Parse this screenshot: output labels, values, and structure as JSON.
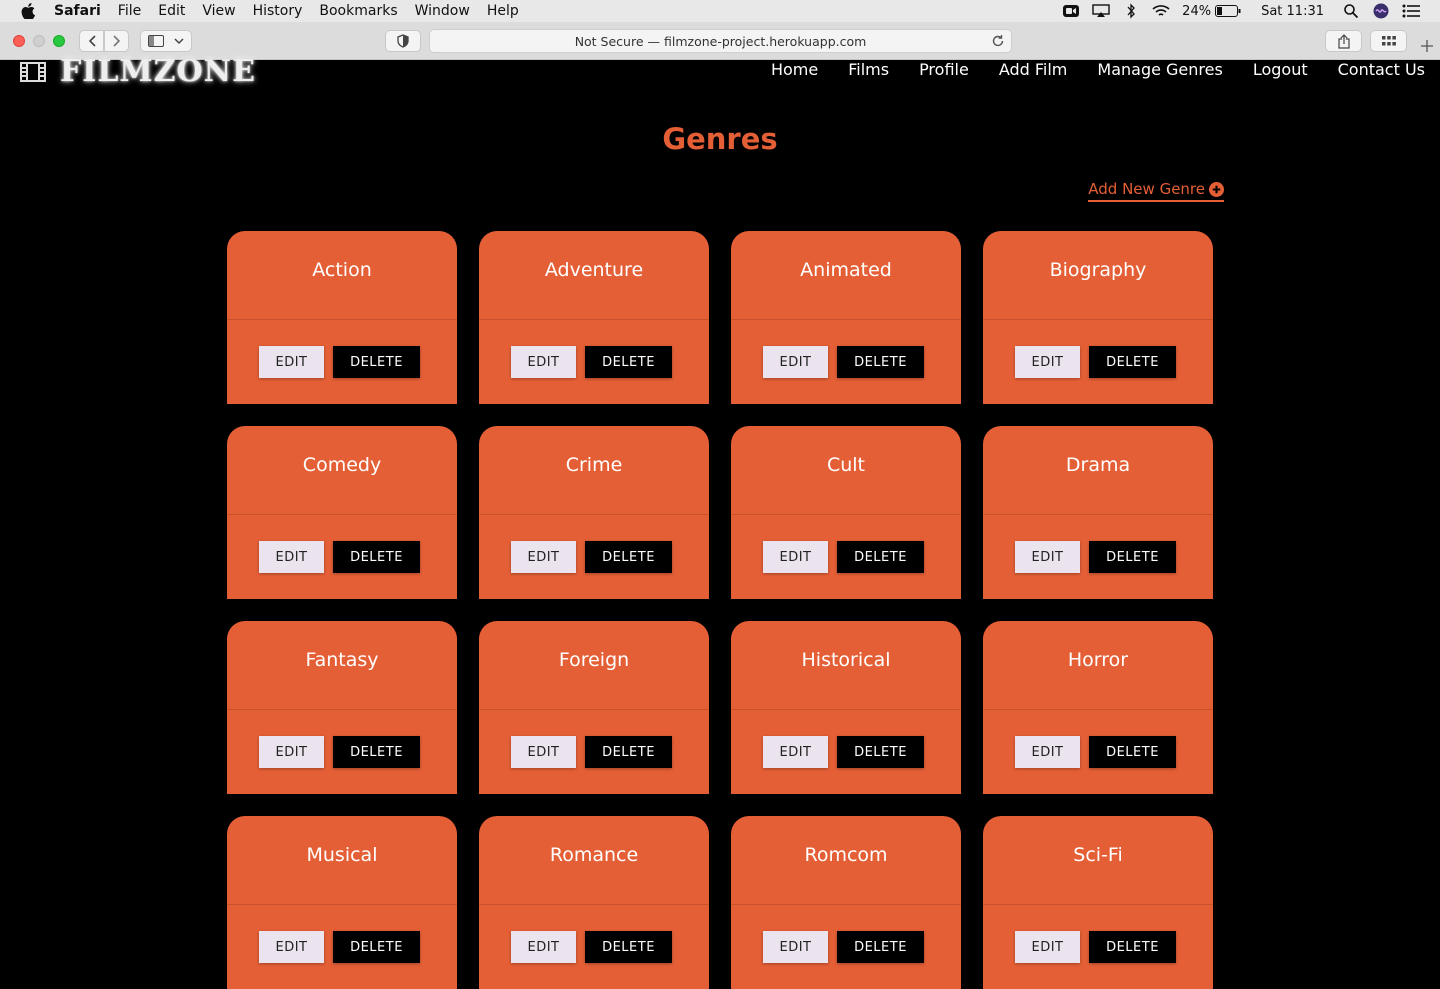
{
  "menubar": {
    "app": "Safari",
    "items": [
      "File",
      "Edit",
      "View",
      "History",
      "Bookmarks",
      "Window",
      "Help"
    ],
    "battery": "24%",
    "clock": "Sat 11:31"
  },
  "browser": {
    "address": "Not Secure — filmzone-project.herokuapp.com"
  },
  "site": {
    "brand": "FILMZONE",
    "nav": [
      "Home",
      "Films",
      "Profile",
      "Add Film",
      "Manage Genres",
      "Logout",
      "Contact Us"
    ],
    "title": "Genres",
    "add_label": "Add New Genre",
    "edit_label": "EDIT",
    "delete_label": "DELETE",
    "genres": [
      "Action",
      "Adventure",
      "Animated",
      "Biography",
      "Comedy",
      "Crime",
      "Cult",
      "Drama",
      "Fantasy",
      "Foreign",
      "Historical",
      "Horror",
      "Musical",
      "Romance",
      "Romcom",
      "Sci-Fi"
    ]
  },
  "colors": {
    "accent": "#e55f36",
    "background": "#000000"
  }
}
